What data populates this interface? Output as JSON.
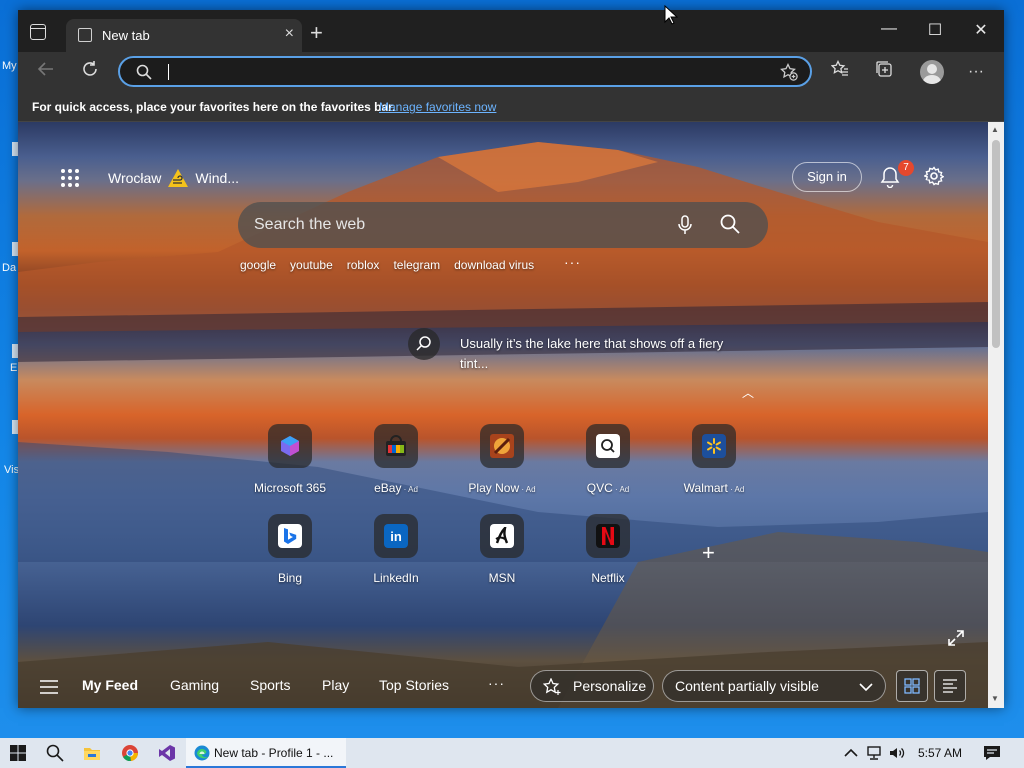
{
  "desktop": {
    "labels": [
      "My",
      "Da",
      "E",
      "Vis"
    ]
  },
  "browser": {
    "tab_title": "New tab",
    "address": {
      "value": "",
      "placeholder": ""
    },
    "favbar": {
      "text": "For quick access, place your favorites here on the favorites bar.",
      "link": "Manage favorites now"
    }
  },
  "newtab": {
    "location": "Wrocław",
    "weather": "Wind...",
    "sign_in": "Sign in",
    "notifications_count": "7",
    "search_placeholder": "Search the web",
    "quick_searches": [
      "google",
      "youtube",
      "roblox",
      "telegram",
      "download virus"
    ],
    "image_info": "Usually it’s the lake here that shows off a fiery tint...",
    "tiles": [
      {
        "label": "Microsoft 365",
        "ad": ""
      },
      {
        "label": "eBay",
        "ad": " · Ad"
      },
      {
        "label": "Play Now",
        "ad": " · Ad"
      },
      {
        "label": "QVC",
        "ad": " · Ad"
      },
      {
        "label": "Walmart",
        "ad": " · Ad"
      },
      {
        "label": "Bing",
        "ad": ""
      },
      {
        "label": "LinkedIn",
        "ad": ""
      },
      {
        "label": "MSN",
        "ad": ""
      },
      {
        "label": "Netflix",
        "ad": ""
      }
    ],
    "feed": {
      "tabs": [
        "My Feed",
        "Gaming",
        "Sports",
        "Play",
        "Top Stories"
      ],
      "personalize": "Personalize",
      "content_visibility": "Content partially visible"
    }
  },
  "taskbar": {
    "task_label": "New tab - Profile 1 - ...",
    "time": "5:57 AM"
  },
  "colors": {
    "accent": "#5aa0e6",
    "link": "#6cb4ff",
    "badge": "#e5482d",
    "taskbar": "#dfe6ef"
  }
}
